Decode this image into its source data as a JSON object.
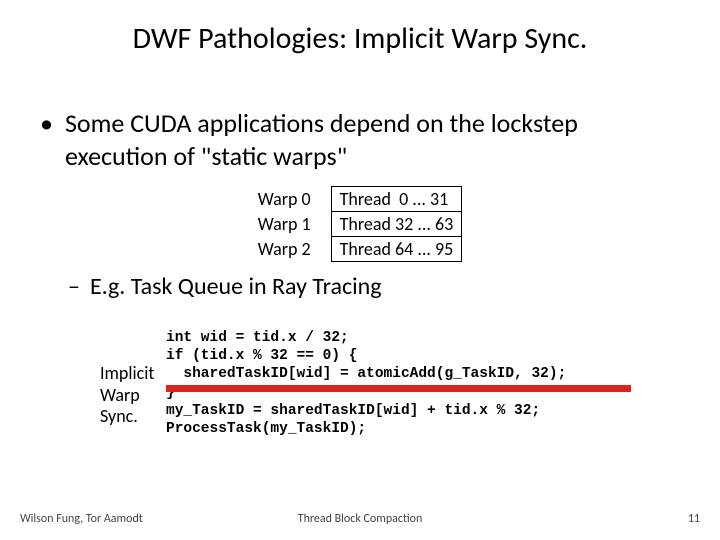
{
  "title": "DWF Pathologies: Implicit Warp Sync.",
  "main_bullet": "Some CUDA applications depend on the lockstep execution of \"static warps\"",
  "warps": {
    "labels": [
      "Warp 0",
      "Warp 1",
      "Warp 2"
    ],
    "threads": [
      "Thread  0 ... 31",
      "Thread 32 ... 63",
      "Thread 64 ... 95"
    ]
  },
  "sub_bullet": "E.g. Task Queue in Ray Tracing",
  "sync_label_lines": [
    "Implicit",
    "Warp",
    "Sync."
  ],
  "code_lines": [
    "int wid = tid.x / 32;",
    "if (tid.x % 32 == 0) {",
    "  sharedTaskID[wid] = atomicAdd(g_TaskID, 32);",
    "}",
    "my_TaskID = sharedTaskID[wid] + tid.x % 32;",
    "ProcessTask(my_TaskID);"
  ],
  "footer": {
    "left": "Wilson Fung, Tor Aamodt",
    "center": "Thread Block Compaction",
    "right": "11"
  }
}
